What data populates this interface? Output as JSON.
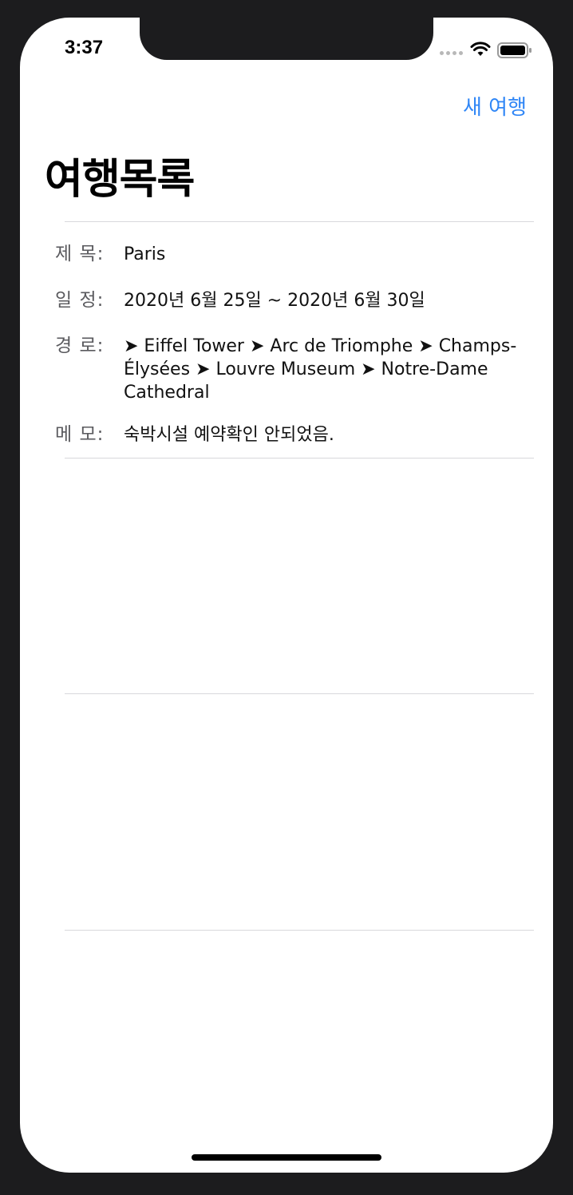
{
  "status_bar": {
    "time": "3:37",
    "icons": [
      "signal-dots-icon",
      "wifi-icon",
      "battery-icon"
    ]
  },
  "nav": {
    "action_label": "새 여행",
    "title": "여행목록",
    "accent_color": "#2f86f6"
  },
  "trips": [
    {
      "title_label": "제 목:",
      "title_value": "Paris",
      "schedule_label": "일 정:",
      "schedule_value": "2020년 6월 25일 ~ 2020년 6월 30일",
      "route_label": "경 로:",
      "route_value": " ➤ Eiffel Tower ➤ Arc de Triomphe ➤ Champs-Élysées ➤ Louvre Museum ➤ Notre-Dame Cathedral",
      "memo_label": "메 모:",
      "memo_value": "숙박시설 예약확인 안되었음."
    }
  ]
}
